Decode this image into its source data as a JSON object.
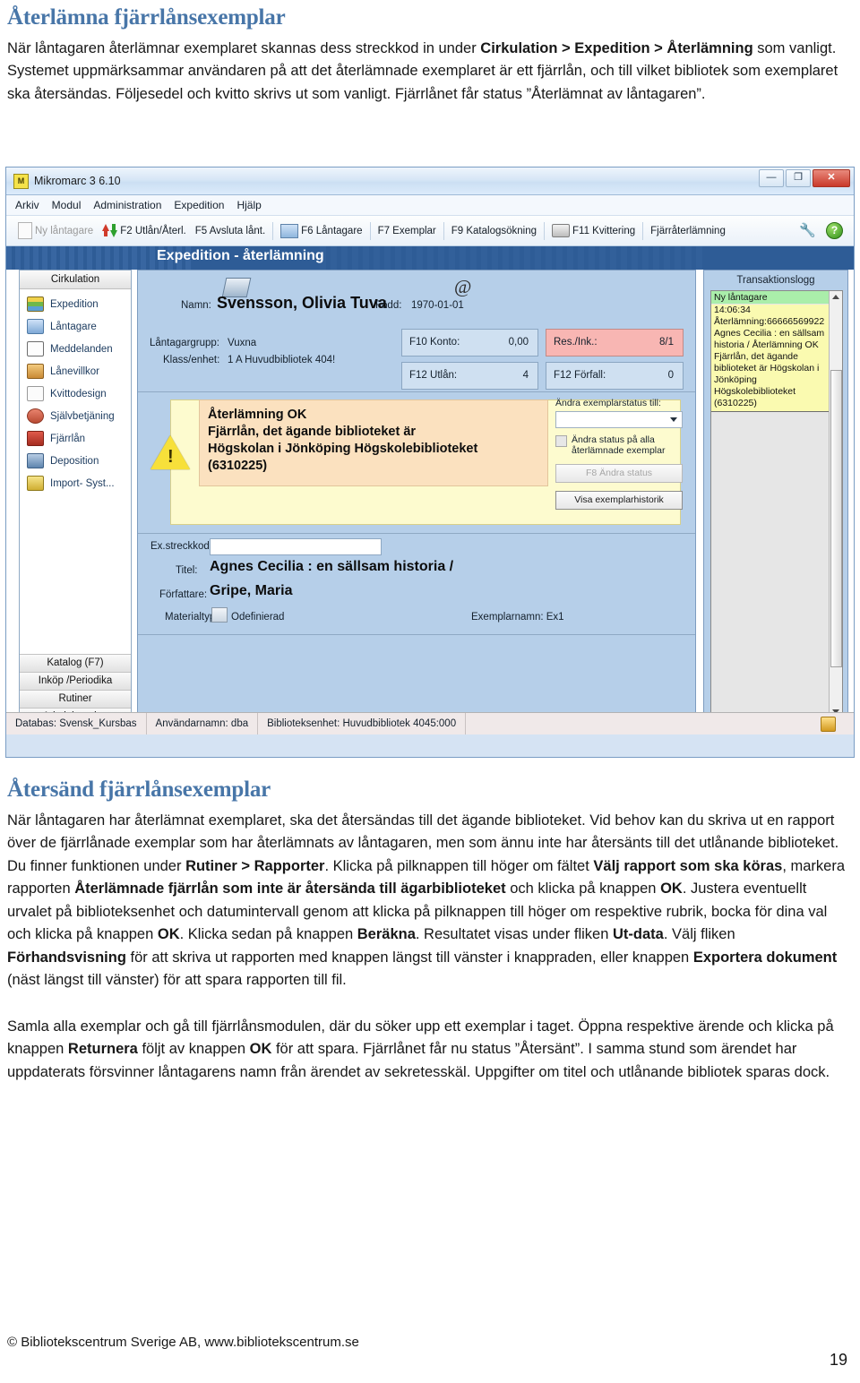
{
  "document": {
    "section1": {
      "heading": "Återlämna fjärrlånsexemplar",
      "paragraph_runs": [
        {
          "t": "När låntagaren återlämnar exemplaret skannas dess streckkod in under ",
          "b": false
        },
        {
          "t": "Cirkulation > Expedition > Återlämning",
          "b": true
        },
        {
          "t": " som vanligt. Systemet uppmärksammar användaren på att det återlämnade exemplaret är ett fjärrlån, och till vilket bibliotek som exemplaret ska återsändas. Följesedel och kvitto skrivs ut som vanligt. Fjärrlånet får status ”Återlämnat av låntagaren”.",
          "b": false
        }
      ]
    },
    "section2": {
      "heading": "Återsänd fjärrlånsexemplar",
      "paragraph1_runs": [
        {
          "t": "När låntagaren har återlämnat exemplaret, ska det återsändas till det ägande biblioteket. Vid behov kan du skriva ut en rapport över de fjärrlånade exemplar som har återlämnats av låntagaren, men som ännu inte har återsänts till det utlånande biblioteket. Du finner funktionen under ",
          "b": false
        },
        {
          "t": "Rutiner > Rapporter",
          "b": true
        },
        {
          "t": ". Klicka på pilknappen till höger om fältet ",
          "b": false
        },
        {
          "t": "Välj rapport som ska köras",
          "b": true
        },
        {
          "t": ", markera rapporten ",
          "b": false
        },
        {
          "t": "Återlämnade fjärrlån som inte är återsända till ägarbiblioteket",
          "b": true
        },
        {
          "t": " och klicka på knappen ",
          "b": false
        },
        {
          "t": "OK",
          "b": true
        },
        {
          "t": ". Justera eventuellt urvalet på biblioteksenhet och datumintervall genom att klicka på pilknappen till höger om respektive rubrik, bocka för dina val och klicka på knappen ",
          "b": false
        },
        {
          "t": "OK",
          "b": true
        },
        {
          "t": ". Klicka sedan på knappen ",
          "b": false
        },
        {
          "t": "Beräkna",
          "b": true
        },
        {
          "t": ". Resultatet visas under fliken ",
          "b": false
        },
        {
          "t": "Ut-data",
          "b": true
        },
        {
          "t": ". Välj fliken ",
          "b": false
        },
        {
          "t": "Förhandsvisning",
          "b": true
        },
        {
          "t": " för att skriva ut rapporten med knappen längst till vänster i knappraden, eller knappen ",
          "b": false
        },
        {
          "t": "Exportera dokument",
          "b": true
        },
        {
          "t": " (näst längst till vänster) för att spara rapporten till fil.",
          "b": false
        }
      ],
      "paragraph2_runs": [
        {
          "t": "Samla alla exemplar och gå till fjärrlånsmodulen, där du söker upp ett exemplar i taget. Öppna respektive ärende och klicka på knappen ",
          "b": false
        },
        {
          "t": "Returnera",
          "b": true
        },
        {
          "t": " följt av knappen ",
          "b": false
        },
        {
          "t": "OK",
          "b": true
        },
        {
          "t": " för att spara. Fjärrlånet får nu status ”Återsänt”. I samma stund som ärendet har uppdaterats försvinner låntagarens namn från ärendet av sekretesskäl. Uppgifter om titel och utlånande bibliotek sparas dock.",
          "b": false
        }
      ]
    },
    "footer": {
      "copyright": "© Bibliotekscentrum Sverige AB, www.bibliotekscentrum.se",
      "page_number": "19"
    }
  },
  "screenshot": {
    "window": {
      "title": "Mikromarc 3 6.10",
      "minimize_label": "—",
      "maximize_label": "❐",
      "close_label": "✕"
    },
    "menu": [
      "Arkiv",
      "Modul",
      "Administration",
      "Expedition",
      "Hjälp"
    ],
    "toolbar": [
      {
        "label": "Ny låntagare",
        "icon": "document-icon",
        "disabled": true
      },
      {
        "label": "F2 Utlån/Återl.",
        "icon": "up-down-arrows-icon",
        "disabled": false
      },
      {
        "label": "F5 Avsluta lånt.",
        "icon": "none",
        "disabled": false
      },
      {
        "label": "F6 Låntagare",
        "icon": "patron-card-icon",
        "disabled": false
      },
      {
        "label": "F7 Exemplar",
        "icon": "none",
        "disabled": false
      },
      {
        "label": "F9 Katalogsökning",
        "icon": "none",
        "disabled": false
      },
      {
        "label": "F11 Kvittering",
        "icon": "printer-icon",
        "disabled": false
      },
      {
        "label": "Fjärråterlämning",
        "icon": "none",
        "disabled": false
      }
    ],
    "banner_title": "Expedition - återlämning",
    "leftnav": {
      "header": "Cirkulation",
      "items": [
        {
          "label": "Expedition",
          "icon": "books-icon"
        },
        {
          "label": "Låntagare",
          "icon": "patron-icon"
        },
        {
          "label": "Meddelanden",
          "icon": "envelope-icon"
        },
        {
          "label": "Lånevillkor",
          "icon": "thumb-icon"
        },
        {
          "label": "Kvittodesign",
          "icon": "pen-icon"
        },
        {
          "label": "Självbetjäning",
          "icon": "selfservice-icon"
        },
        {
          "label": "Fjärrlån",
          "icon": "ill-icon"
        },
        {
          "label": "Deposition",
          "icon": "deposit-icon"
        },
        {
          "label": "Import- Syst...",
          "icon": "import-icon"
        }
      ],
      "footer_buttons": [
        "Katalog (F7)",
        "Inköp /Periodika",
        "Rutiner",
        "Administration"
      ]
    },
    "patron": {
      "namn_label": "Namn:",
      "namn_value": "Svensson, Olivia Tuva",
      "fodd_label": "Född:",
      "fodd_value": "1970-01-01",
      "grupp_label": "Låntagargrupp:",
      "grupp_value": "Vuxna",
      "klass_label": "Klass/enhet:",
      "klass_value": "1 A Huvudbibliotek 404!",
      "stats": [
        {
          "key": "F10 Konto:",
          "value": "0,00"
        },
        {
          "key": "Res./Ink.:",
          "value": "8/1"
        },
        {
          "key": "F12 Utlån:",
          "value": "4"
        },
        {
          "key": "F12 Förfall:",
          "value": "0"
        }
      ]
    },
    "alert": {
      "lines": [
        "Återlämning OK",
        "Fjärrlån, det ägande biblioteket är",
        "Högskolan i Jönköping Högskolebiblioteket",
        "(6310225)"
      ],
      "status_label": "Ändra exemplarstatus till:",
      "status_value": "",
      "checkbox_label": "Ändra status på alla återlämnade exemplar",
      "change_status_button": "F8 Ändra status",
      "history_button": "Visa exemplarhistorik"
    },
    "item": {
      "barcode_label": "Ex.streckkod:",
      "barcode_value": "",
      "titel_label": "Titel:",
      "titel_value": "Agnes Cecilia : en sällsam historia /",
      "forfattare_label": "Författare:",
      "forfattare_value": "Gripe, Maria",
      "materialtyp_label": "Materialtyp:",
      "materialtyp_value": "Odefinierad",
      "exemplarnamn_label": "Exemplarnamn:",
      "exemplarnamn_value": "Ex1"
    },
    "translog": {
      "title": "Transaktionslogg",
      "header": "Ny låntagare",
      "body": "14:06:34\nÅterlämning:66666569922\nAgnes Cecilia : en sällsam historia /\nÅterlämning OK\nFjärrlån, det ägande biblioteket är Högskolan i Jönköping Högskolebiblioteket (6310225)"
    },
    "statusbar": {
      "database": "Databas: Svensk_Kursbas",
      "user": "Användarnamn: dba",
      "unit": "Biblioteksenhet: Huvudbibliotek 4045:000"
    }
  },
  "colors": {
    "heading": "#4876a8",
    "panel_blue": "#b6cfe9",
    "banner_blue": "#2e5c96",
    "alert_yellow": "#fdfbcf",
    "alert_orange": "#fbe1bf",
    "alert_red": "#f8b6b3",
    "log_green": "#aaeeaa",
    "log_yellow": "#fafab0"
  }
}
